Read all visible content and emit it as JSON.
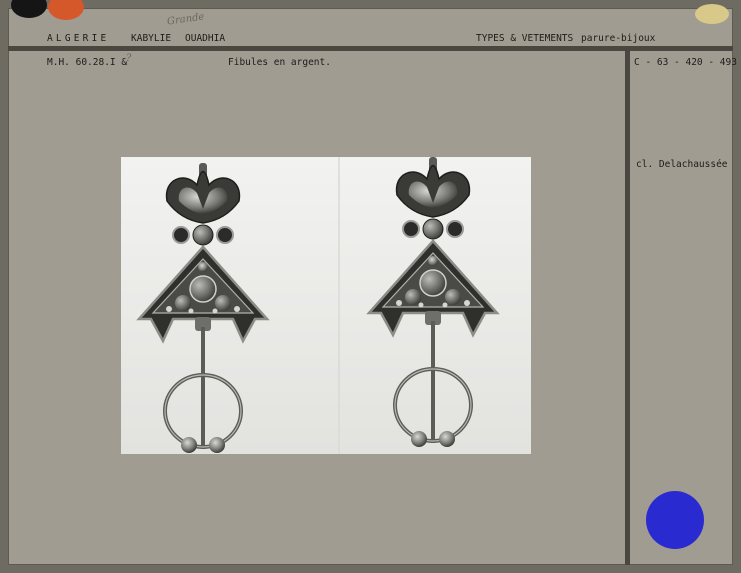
{
  "header": {
    "region": "ALGERIE",
    "area": "KABYLIE",
    "village": "OUADHIA",
    "handwritten_note": "Grande",
    "category": "TYPES & VETEMENTS",
    "subcategory": "parure-bijoux"
  },
  "record": {
    "inventory_number": "M.H. 60.28.I &",
    "inventory_mark": "?",
    "description": "Fibules en argent.",
    "catalog_number": "C - 63 - 420 - 493",
    "credit": "cl. Delachaussée"
  },
  "photo": {
    "subject": "two fibula brooches"
  },
  "colors": {
    "card": "#a19c92",
    "rule": "#4a4740",
    "dot_black": "#151515",
    "dot_orange": "#d4582a",
    "dot_gold": "#d8c98a",
    "dot_blue": "#2a2ad1"
  }
}
